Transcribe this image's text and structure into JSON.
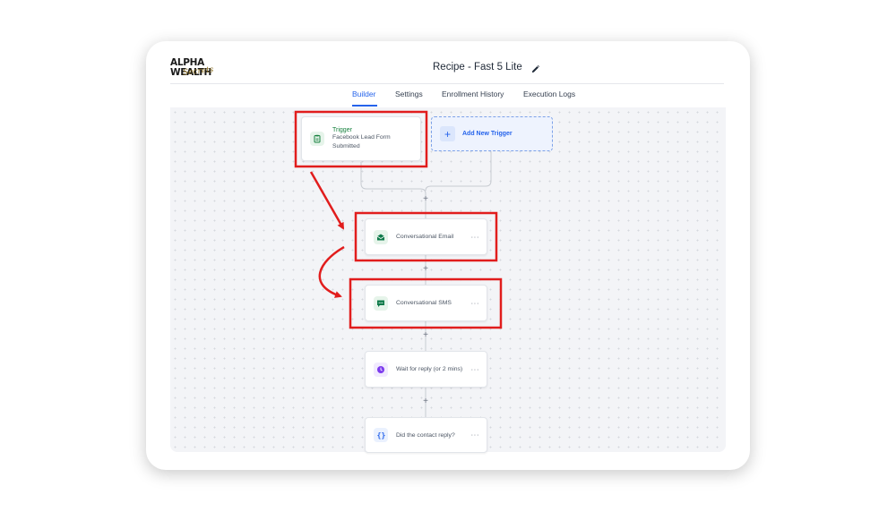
{
  "brand": {
    "logo_main": "ALPHA WEALTH",
    "logo_sub": "Secrets"
  },
  "header": {
    "title": "Recipe - Fast 5 Lite",
    "edit_icon": "pencil-icon"
  },
  "tabs": [
    {
      "label": "Builder",
      "active": true
    },
    {
      "label": "Settings",
      "active": false
    },
    {
      "label": "Enrollment History",
      "active": false
    },
    {
      "label": "Execution Logs",
      "active": false
    }
  ],
  "trigger": {
    "label": "Trigger",
    "description_line1": "Facebook Lead Form",
    "description_line2": "Submitted",
    "icon": "clipboard-icon"
  },
  "add_trigger": {
    "label": "Add New Trigger",
    "icon": "plus-icon"
  },
  "steps": [
    {
      "label": "Conversational Email",
      "icon": "envelope-icon",
      "more": "···"
    },
    {
      "label": "Conversational SMS",
      "icon": "chat-icon",
      "more": "···"
    },
    {
      "label": "Wait for reply (or 2 mins)",
      "icon": "clock-icon",
      "more": "···"
    },
    {
      "label": "Did the contact reply?",
      "icon": "braces-icon",
      "more": "···"
    }
  ],
  "plus_symbol": "+",
  "colors": {
    "accent": "#2563eb",
    "highlight": "#e11d1d",
    "trigger_green": "#15803d",
    "email_green": "#0f7a4a",
    "wait_purple": "#7c3aed"
  }
}
